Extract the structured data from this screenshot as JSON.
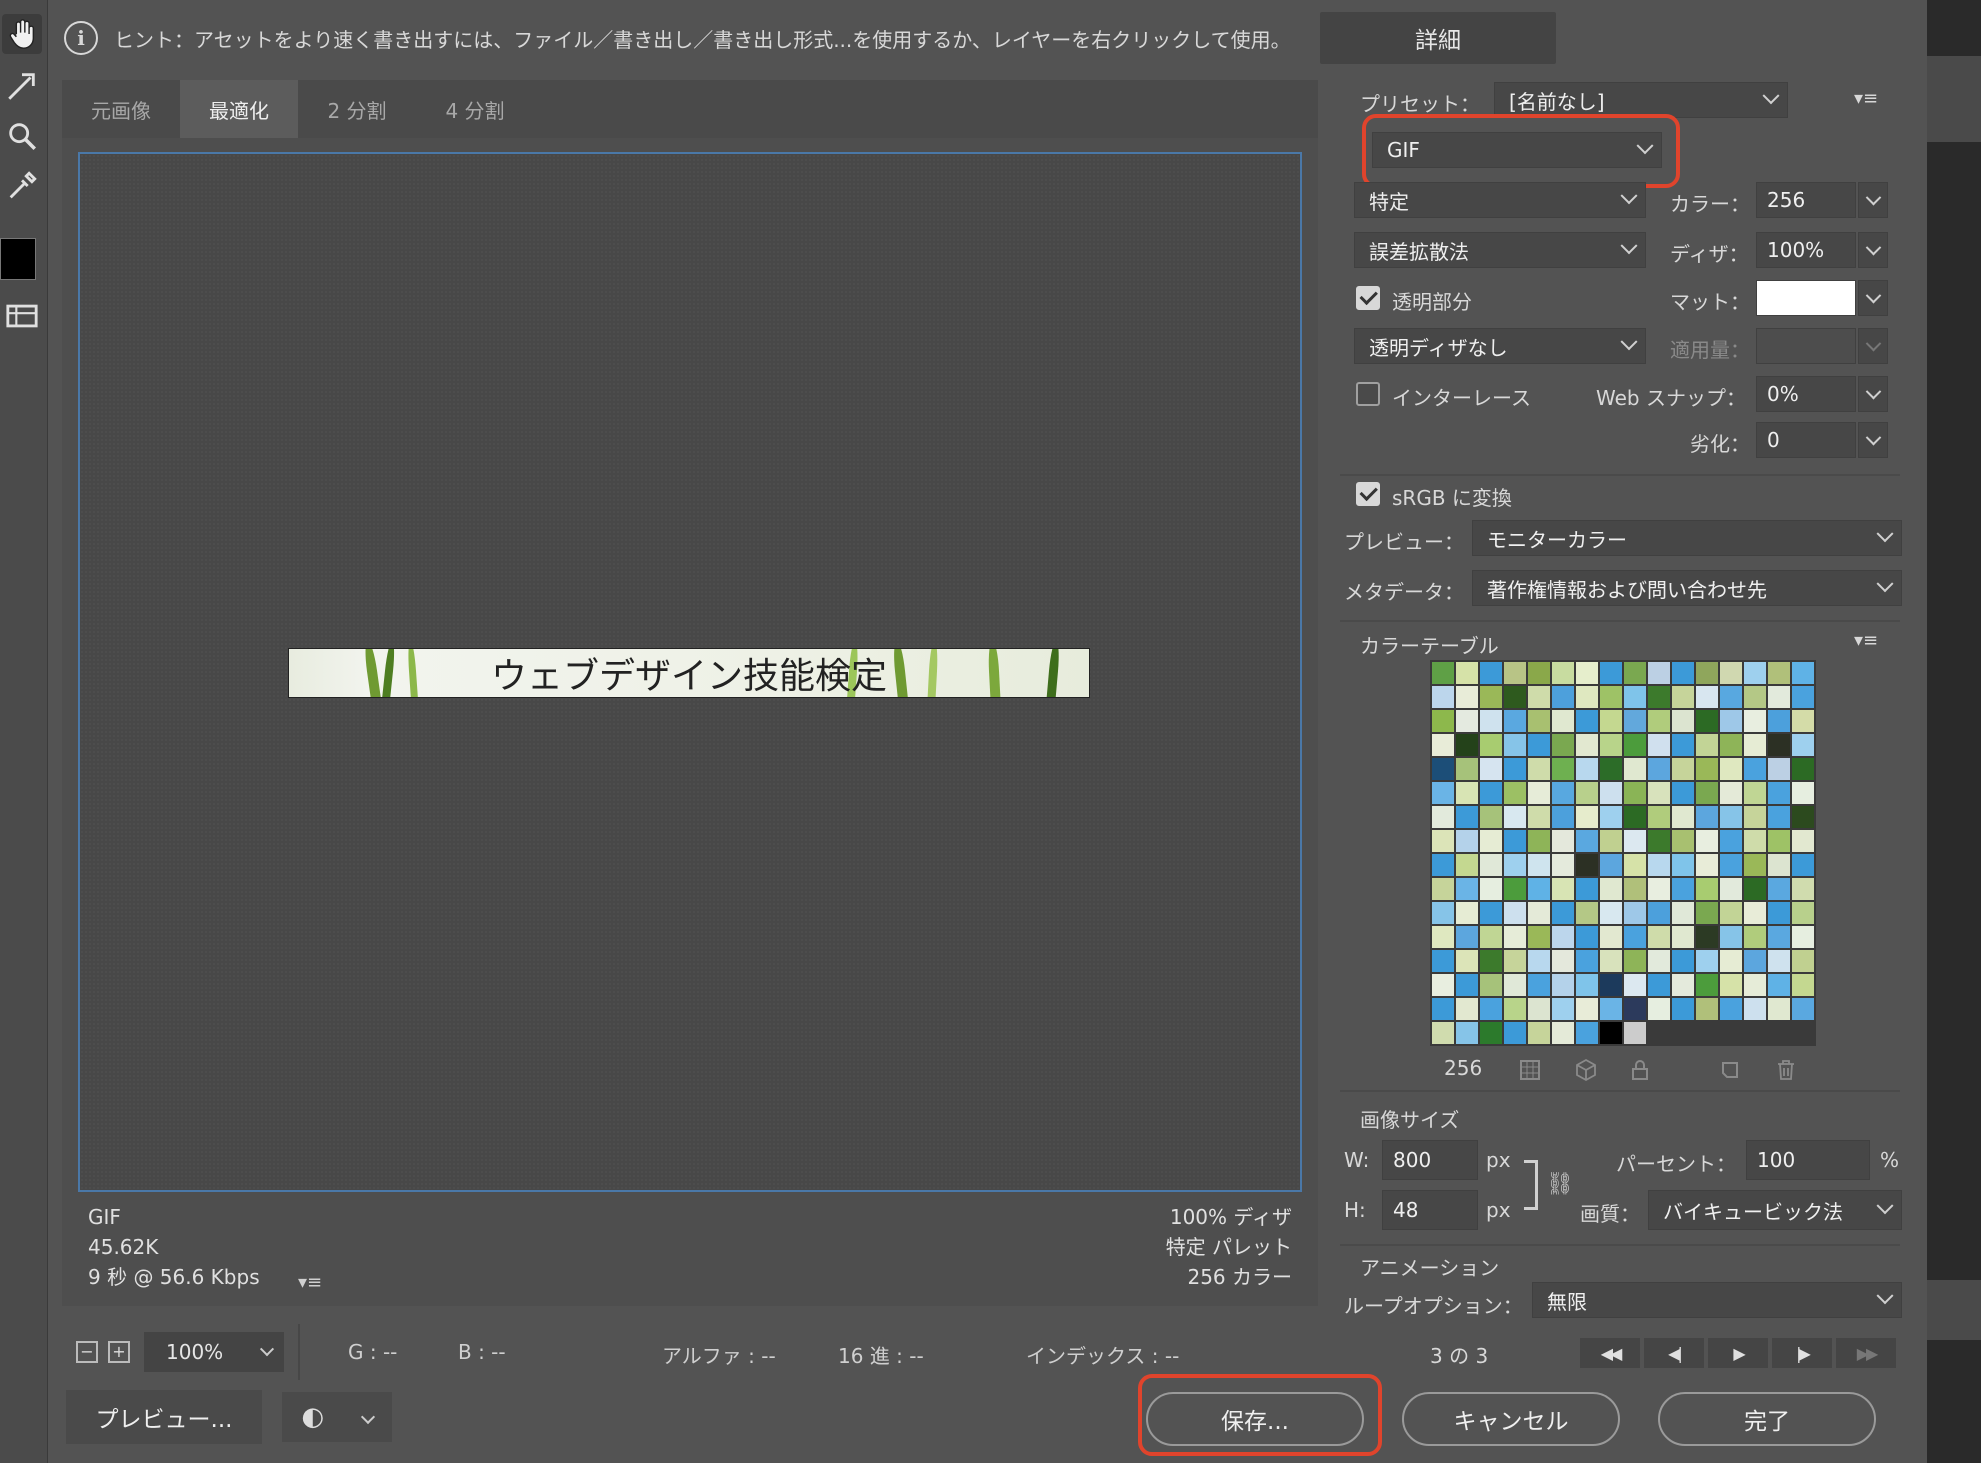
{
  "hint": {
    "text": "ヒント：アセットをより速く書き出すには、ファイル／書き出し／書き出し形式...を使用するか、レイヤーを右クリックして使用。",
    "detail_button": "詳細"
  },
  "tabs": [
    {
      "label": "元画像",
      "active": false
    },
    {
      "label": "最適化",
      "active": true
    },
    {
      "label": "2 分割",
      "active": false
    },
    {
      "label": "4 分割",
      "active": false
    }
  ],
  "preview": {
    "banner_text": "ウェブデザイン技能検定",
    "info_left": [
      "GIF",
      "45.62K",
      "9 秒 @ 56.6 Kbps"
    ],
    "info_right": [
      "100% ディザ",
      "特定 パレット",
      "256 カラー"
    ]
  },
  "status": {
    "zoom": "100%",
    "g": "G : --",
    "b": "B : --",
    "alpha": "アルファ : --",
    "hex": "16 進 : --",
    "index": "インデックス : --"
  },
  "buttons": {
    "preview": "プレビュー...",
    "save": "保存...",
    "cancel": "キャンセル",
    "done": "完了"
  },
  "settings": {
    "preset_label": "プリセット：",
    "preset_value": "[名前なし]",
    "format": "GIF",
    "reduction": "特定",
    "colors_label": "カラー：",
    "colors": "256",
    "dither_algo": "誤差拡散法",
    "dither_label": "ディザ：",
    "dither": "100%",
    "transparency_label": "透明部分",
    "transparency_checked": true,
    "matte_label": "マット：",
    "trans_dither": "透明ディザなし",
    "amount_label": "適用量：",
    "interlace_label": "インターレース",
    "interlace_checked": false,
    "websnap_label": "Web スナップ：",
    "websnap": "0%",
    "lossy_label": "劣化：",
    "lossy": "0",
    "srgb_label": "sRGB に変換",
    "srgb_checked": true,
    "preview_label": "プレビュー：",
    "preview_value": "モニターカラー",
    "metadata_label": "メタデータ：",
    "metadata_value": "著作権情報および問い合わせ先"
  },
  "color_table": {
    "title": "カラーテーブル",
    "count": "256",
    "palette": [
      "#5fa046",
      "#d6e2a8",
      "#3c9ad8",
      "#b8c486",
      "#8aa84a",
      "#c8dca0",
      "#e6eecc",
      "#3c9ad8",
      "#7aa850",
      "#bcd0e4",
      "#3c9ad8",
      "#8fa65c",
      "#d0d8b0",
      "#9ed0ee",
      "#b0c07a",
      "#5fb2e6",
      "#bcd6ec",
      "#e8ecd8",
      "#9ab858",
      "#2e5a1e",
      "#cfdcaa",
      "#4da0dc",
      "#dfe8c0",
      "#9ec266",
      "#7fc4ea",
      "#3c7a2c",
      "#c6d49a",
      "#d8e6f0",
      "#58a8e0",
      "#b4c886",
      "#e2eadc",
      "#4aa2de",
      "#8db84c",
      "#e4eae0",
      "#cfe2ee",
      "#5aa8e0",
      "#a8c070",
      "#e0e8d0",
      "#3c9ad8",
      "#c4d890",
      "#62a8dc",
      "#b0cc7c",
      "#dce4d0",
      "#2c6a24",
      "#9ec8e8",
      "#e8eee0",
      "#4ca0dc",
      "#d4dca8",
      "#e8ecd8",
      "#24421a",
      "#a8cc70",
      "#86c4e8",
      "#3c9ad8",
      "#7aa850",
      "#e2e8d0",
      "#b8d48a",
      "#4c9c3c",
      "#d0e0ee",
      "#3c9ad8",
      "#c2d496",
      "#8eb458",
      "#e6ecd4",
      "#2c3024",
      "#9ed0ee",
      "#1c4e78",
      "#a6c27a",
      "#d6e4f0",
      "#3c9ad8",
      "#cfdcaa",
      "#6eb050",
      "#b8d8ee",
      "#2c6c28",
      "#e0e8d0",
      "#5ca6de",
      "#c6d49a",
      "#9ab858",
      "#dfe8c0",
      "#4aa2de",
      "#bcd0e4",
      "#2c6a24",
      "#6ab4e6",
      "#d8e4b4",
      "#3c9ad8",
      "#9cc064",
      "#e6ecd8",
      "#58a8e0",
      "#b8d08c",
      "#cde0ee",
      "#8ab456",
      "#d8e2bc",
      "#3c9ad8",
      "#7aa850",
      "#e4ead8",
      "#c0d694",
      "#4aa2de",
      "#e6eee0",
      "#e2eadc",
      "#3c9ad8",
      "#a6c27a",
      "#d8e8f0",
      "#cfdcaa",
      "#4ca0dc",
      "#e6eccc",
      "#9ed0ee",
      "#2c6a24",
      "#b0cc7c",
      "#e0e8d0",
      "#5ca6de",
      "#86c4e8",
      "#c6d49a",
      "#4aa2de",
      "#2c4a1e",
      "#dce4b8",
      "#b4d2ea",
      "#e6ecd4",
      "#3c9ad8",
      "#8eb458",
      "#e4e8dc",
      "#5aa8e0",
      "#c0d090",
      "#dce8f0",
      "#3c7a2c",
      "#a8c070",
      "#e8eee0",
      "#4aa2de",
      "#cfdcaa",
      "#9ec266",
      "#e2e8d0",
      "#3c9ad8",
      "#c4d890",
      "#e0e8d8",
      "#9ed0ee",
      "#cfe4ee",
      "#e4eadc",
      "#2c3024",
      "#5ca6de",
      "#d6e2a8",
      "#b8d8ee",
      "#7fc4ea",
      "#e8ecd8",
      "#4aa2de",
      "#9ab858",
      "#dce4d0",
      "#3c9ad8",
      "#c6d49a",
      "#6ab4e6",
      "#e6eee0",
      "#4c9c3c",
      "#5fb2e6",
      "#d8e4b4",
      "#3c9ad8",
      "#e0e8d0",
      "#b0c07a",
      "#e8eee0",
      "#4aa2de",
      "#a8cc70",
      "#e2eadc",
      "#2c6a24",
      "#5aa8e0",
      "#d0dcae",
      "#86c4e8",
      "#e6ecd4",
      "#3c9ad8",
      "#cde0ee",
      "#e4ead8",
      "#3c9ad8",
      "#b4c886",
      "#d8e8f0",
      "#9ec8e8",
      "#4ca0dc",
      "#e0e8d8",
      "#7aa850",
      "#c2d496",
      "#e8ecd8",
      "#3c9ad8",
      "#b8d08c",
      "#dfe8c0",
      "#5ca6de",
      "#c0d694",
      "#e6ecd8",
      "#9ab858",
      "#bcd6ec",
      "#3c9ad8",
      "#e2e8d0",
      "#4aa2de",
      "#cfdcaa",
      "#e0e8d0",
      "#2c3a24",
      "#86c4e8",
      "#b0cc7c",
      "#5aa8e0",
      "#e6eee0",
      "#3c9ad8",
      "#dce4b8",
      "#3c7a2c",
      "#c6d49a",
      "#b8d8ee",
      "#e4e8dc",
      "#4aa2de",
      "#d8e2bc",
      "#8eb458",
      "#e2eadc",
      "#3c9ad8",
      "#9ed0ee",
      "#e6ecd4",
      "#5ca6de",
      "#cfe2ee",
      "#c0d090",
      "#e8eee0",
      "#3c9ad8",
      "#a6c27a",
      "#e0e8d8",
      "#4aa2de",
      "#b4d2ea",
      "#7fc4ea",
      "#1c3a5c",
      "#dce8f0",
      "#3c9ad8",
      "#e4eadc",
      "#4c9c3c",
      "#d6e2a8",
      "#e6ecd8",
      "#5fb2e6",
      "#c4d890",
      "#3c9ad8",
      "#e2e8d0",
      "#4aa2de",
      "#b8d48a",
      "#dce4d0",
      "#9ed0ee",
      "#e8ecd8",
      "#6ab4e6",
      "#2c3a5c",
      "#e6eee0",
      "#3c9ad8",
      "#b0c07a",
      "#4aa2de",
      "#cde0ee",
      "#e0e8d0",
      "#5aa8e0",
      "#d0dcae",
      "#86c4e8",
      "#2c7a2c",
      "#3c9ad8",
      "#c6d49a",
      "#e4ead8",
      "#4aa2de",
      "#000000",
      "#cccccc"
    ]
  },
  "image_size": {
    "title": "画像サイズ",
    "w_label": "W:",
    "w": "800",
    "h_label": "H:",
    "h": "48",
    "unit": "px",
    "percent_label": "パーセント：",
    "percent": "100",
    "percent_unit": "%",
    "quality_label": "画質：",
    "quality": "バイキュービック法"
  },
  "animation": {
    "title": "アニメーション",
    "loop_label": "ループオプション：",
    "loop": "無限",
    "frame": "3 の 3"
  },
  "colors": {
    "highlight": "#e0442c",
    "accent_border": "#4a78a8"
  }
}
